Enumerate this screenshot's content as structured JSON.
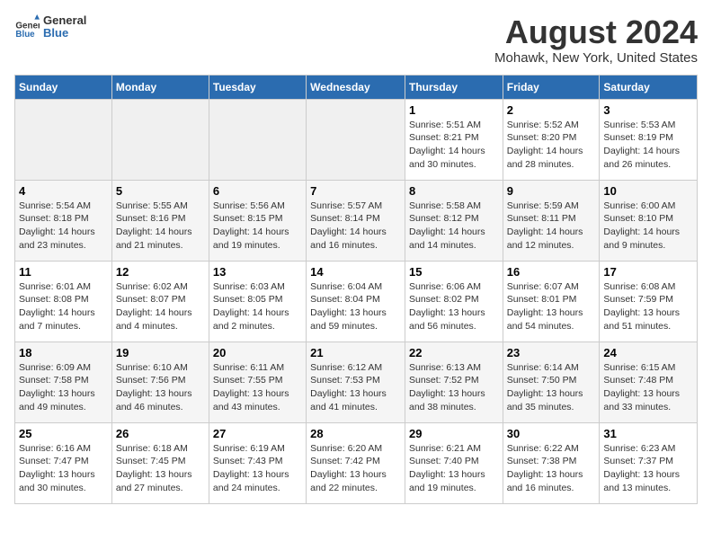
{
  "header": {
    "logo_line1": "General",
    "logo_line2": "Blue",
    "main_title": "August 2024",
    "subtitle": "Mohawk, New York, United States"
  },
  "days_of_week": [
    "Sunday",
    "Monday",
    "Tuesday",
    "Wednesday",
    "Thursday",
    "Friday",
    "Saturday"
  ],
  "weeks": [
    [
      {
        "day": "",
        "info": ""
      },
      {
        "day": "",
        "info": ""
      },
      {
        "day": "",
        "info": ""
      },
      {
        "day": "",
        "info": ""
      },
      {
        "day": "1",
        "info": "Sunrise: 5:51 AM\nSunset: 8:21 PM\nDaylight: 14 hours\nand 30 minutes."
      },
      {
        "day": "2",
        "info": "Sunrise: 5:52 AM\nSunset: 8:20 PM\nDaylight: 14 hours\nand 28 minutes."
      },
      {
        "day": "3",
        "info": "Sunrise: 5:53 AM\nSunset: 8:19 PM\nDaylight: 14 hours\nand 26 minutes."
      }
    ],
    [
      {
        "day": "4",
        "info": "Sunrise: 5:54 AM\nSunset: 8:18 PM\nDaylight: 14 hours\nand 23 minutes."
      },
      {
        "day": "5",
        "info": "Sunrise: 5:55 AM\nSunset: 8:16 PM\nDaylight: 14 hours\nand 21 minutes."
      },
      {
        "day": "6",
        "info": "Sunrise: 5:56 AM\nSunset: 8:15 PM\nDaylight: 14 hours\nand 19 minutes."
      },
      {
        "day": "7",
        "info": "Sunrise: 5:57 AM\nSunset: 8:14 PM\nDaylight: 14 hours\nand 16 minutes."
      },
      {
        "day": "8",
        "info": "Sunrise: 5:58 AM\nSunset: 8:12 PM\nDaylight: 14 hours\nand 14 minutes."
      },
      {
        "day": "9",
        "info": "Sunrise: 5:59 AM\nSunset: 8:11 PM\nDaylight: 14 hours\nand 12 minutes."
      },
      {
        "day": "10",
        "info": "Sunrise: 6:00 AM\nSunset: 8:10 PM\nDaylight: 14 hours\nand 9 minutes."
      }
    ],
    [
      {
        "day": "11",
        "info": "Sunrise: 6:01 AM\nSunset: 8:08 PM\nDaylight: 14 hours\nand 7 minutes."
      },
      {
        "day": "12",
        "info": "Sunrise: 6:02 AM\nSunset: 8:07 PM\nDaylight: 14 hours\nand 4 minutes."
      },
      {
        "day": "13",
        "info": "Sunrise: 6:03 AM\nSunset: 8:05 PM\nDaylight: 14 hours\nand 2 minutes."
      },
      {
        "day": "14",
        "info": "Sunrise: 6:04 AM\nSunset: 8:04 PM\nDaylight: 13 hours\nand 59 minutes."
      },
      {
        "day": "15",
        "info": "Sunrise: 6:06 AM\nSunset: 8:02 PM\nDaylight: 13 hours\nand 56 minutes."
      },
      {
        "day": "16",
        "info": "Sunrise: 6:07 AM\nSunset: 8:01 PM\nDaylight: 13 hours\nand 54 minutes."
      },
      {
        "day": "17",
        "info": "Sunrise: 6:08 AM\nSunset: 7:59 PM\nDaylight: 13 hours\nand 51 minutes."
      }
    ],
    [
      {
        "day": "18",
        "info": "Sunrise: 6:09 AM\nSunset: 7:58 PM\nDaylight: 13 hours\nand 49 minutes."
      },
      {
        "day": "19",
        "info": "Sunrise: 6:10 AM\nSunset: 7:56 PM\nDaylight: 13 hours\nand 46 minutes."
      },
      {
        "day": "20",
        "info": "Sunrise: 6:11 AM\nSunset: 7:55 PM\nDaylight: 13 hours\nand 43 minutes."
      },
      {
        "day": "21",
        "info": "Sunrise: 6:12 AM\nSunset: 7:53 PM\nDaylight: 13 hours\nand 41 minutes."
      },
      {
        "day": "22",
        "info": "Sunrise: 6:13 AM\nSunset: 7:52 PM\nDaylight: 13 hours\nand 38 minutes."
      },
      {
        "day": "23",
        "info": "Sunrise: 6:14 AM\nSunset: 7:50 PM\nDaylight: 13 hours\nand 35 minutes."
      },
      {
        "day": "24",
        "info": "Sunrise: 6:15 AM\nSunset: 7:48 PM\nDaylight: 13 hours\nand 33 minutes."
      }
    ],
    [
      {
        "day": "25",
        "info": "Sunrise: 6:16 AM\nSunset: 7:47 PM\nDaylight: 13 hours\nand 30 minutes."
      },
      {
        "day": "26",
        "info": "Sunrise: 6:18 AM\nSunset: 7:45 PM\nDaylight: 13 hours\nand 27 minutes."
      },
      {
        "day": "27",
        "info": "Sunrise: 6:19 AM\nSunset: 7:43 PM\nDaylight: 13 hours\nand 24 minutes."
      },
      {
        "day": "28",
        "info": "Sunrise: 6:20 AM\nSunset: 7:42 PM\nDaylight: 13 hours\nand 22 minutes."
      },
      {
        "day": "29",
        "info": "Sunrise: 6:21 AM\nSunset: 7:40 PM\nDaylight: 13 hours\nand 19 minutes."
      },
      {
        "day": "30",
        "info": "Sunrise: 6:22 AM\nSunset: 7:38 PM\nDaylight: 13 hours\nand 16 minutes."
      },
      {
        "day": "31",
        "info": "Sunrise: 6:23 AM\nSunset: 7:37 PM\nDaylight: 13 hours\nand 13 minutes."
      }
    ]
  ]
}
